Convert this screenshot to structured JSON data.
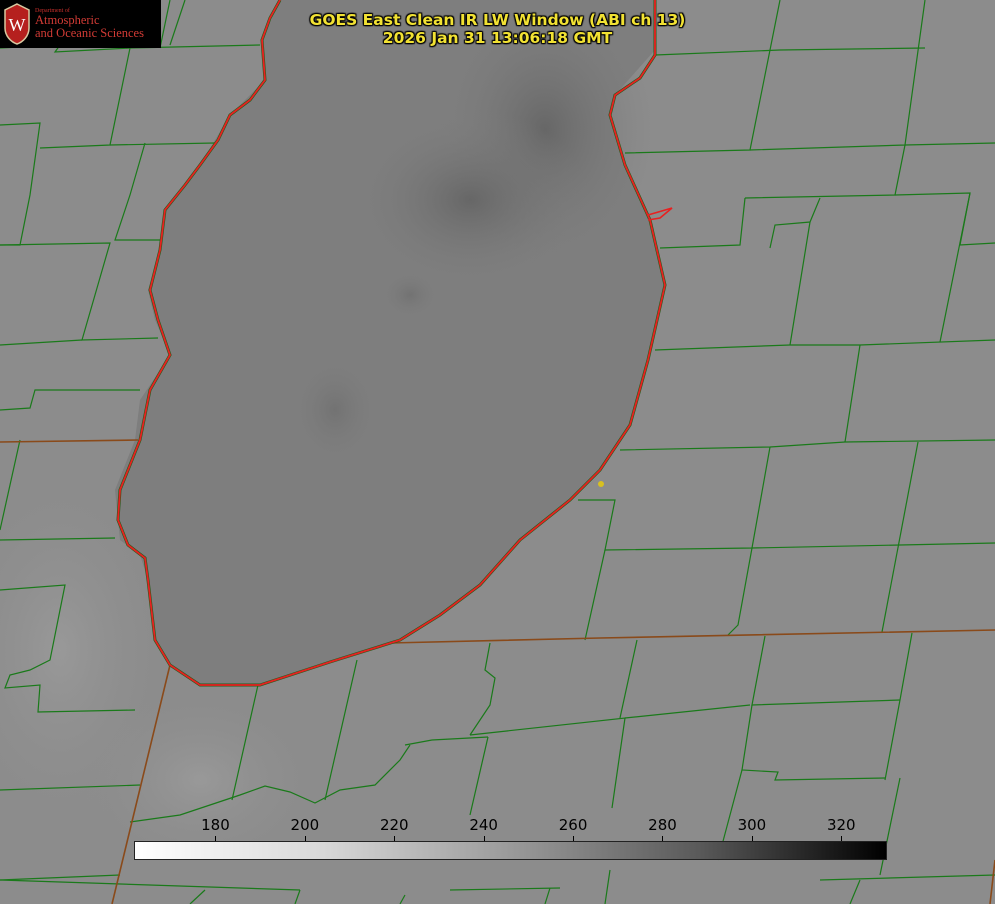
{
  "title": {
    "line1": "GOES East Clean IR LW Window (ABI ch 13)",
    "line2": "2026 Jan 31 13:06:18 GMT"
  },
  "logo": {
    "department": "Department of",
    "line1": "Atmospheric",
    "line2": "and Oceanic Sciences",
    "seal_letter": "W"
  },
  "colorbar": {
    "ticks": [
      "180",
      "200",
      "220",
      "240",
      "260",
      "280",
      "300",
      "320"
    ],
    "tick_values": [
      180,
      200,
      220,
      240,
      260,
      280,
      300,
      320
    ],
    "range": [
      162,
      330
    ],
    "colormap": "white-to-black"
  },
  "colors": {
    "background": "#8d8d8d",
    "lake": "#7f7f7f",
    "county_lines": "#1a7a1a",
    "state_lines": "#8a4a1a",
    "shoreline": "#e82020",
    "title": "#f2e233",
    "marker": "#d8c020"
  },
  "map": {
    "feature": "lake-michigan-southern-basin",
    "marker_icon": "yellow-dot-icon"
  }
}
